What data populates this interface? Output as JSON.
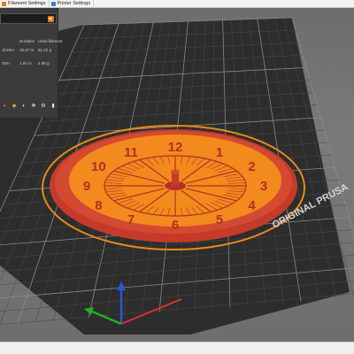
{
  "tabs": [
    {
      "label": "Filament Settings",
      "icon_color": "#e07a1a"
    },
    {
      "label": "Printer Settings",
      "icon_color": "#3a7bd5"
    }
  ],
  "sidebar": {
    "headers": {
      "time": "Duration",
      "used": "Used filament"
    },
    "stats": [
      {
        "time": "1h16m",
        "duration": "19.47 m",
        "used": "51.22 g"
      },
      {
        "time": "30m",
        "duration": "1.64 m",
        "used": "4.89 g"
      }
    ],
    "icons": [
      "paint-icon",
      "brush-icon",
      "seam-icon",
      "layers-icon",
      "gear-icon",
      "pin-icon"
    ]
  },
  "bed": {
    "label": "ORIGINAL PRUSA",
    "colors": {
      "bed": "#2d2d2d",
      "grid_minor": "#4a4a4a",
      "grid_major": "#8a8a8a"
    }
  },
  "clock_model": {
    "numerals": [
      "12",
      "1",
      "2",
      "3",
      "4",
      "5",
      "6",
      "7",
      "8",
      "9",
      "10",
      "11"
    ],
    "colors": {
      "face": "#f28a1e",
      "rim": "#c43b2b",
      "detail": "#b52f22",
      "outline": "#e88a1a"
    }
  },
  "axes": {
    "x_color": "#e03030",
    "y_color": "#22b022",
    "z_color": "#2a56d8"
  }
}
